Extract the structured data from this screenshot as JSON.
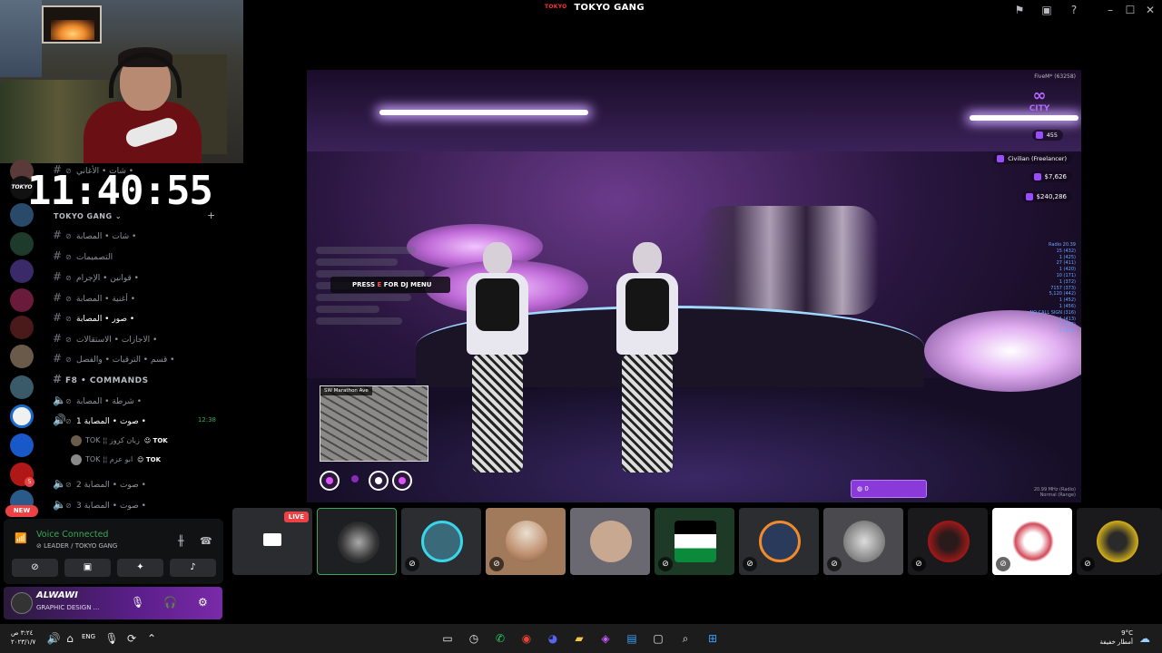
{
  "window": {
    "title": "TOKYO GANG",
    "logo_text": "TOKYO"
  },
  "titlebar_icons": [
    "inbox-flag-icon",
    "screen-share-icon",
    "help-icon",
    "minimize-icon",
    "maximize-icon",
    "close-icon"
  ],
  "overlay_clock": "11:40:55",
  "server_rail": {
    "new_badge": "NEW",
    "small_badge": "5",
    "tokyo_label": "TOKYO"
  },
  "channels": {
    "guild_name": "TOKYO GANG",
    "top_partial": "شات • الأغاني •",
    "items": [
      {
        "name": "شات • المصابة •",
        "type": "text"
      },
      {
        "name": "التصميمات",
        "type": "text"
      },
      {
        "name": "قوانين • الإجرام •",
        "type": "text"
      },
      {
        "name": "أغنية • المصابة •",
        "type": "text"
      },
      {
        "name": "صور • المصابة •",
        "type": "text",
        "active": true
      },
      {
        "name": "الاجازات • الاستقالات •",
        "type": "text"
      },
      {
        "name": "قسم • الترقيات • والفصل •",
        "type": "text"
      }
    ],
    "category": "F8 • COMMANDS",
    "voice_channels": [
      {
        "name": "شرطة • المصابة •",
        "time": ""
      },
      {
        "name": "صوت • المصابة 1 •",
        "time": "12:38",
        "active": true
      },
      {
        "name": "صوت • المصابة 2 •",
        "time": ""
      },
      {
        "name": "صوت • المصابة 3 •",
        "time": ""
      }
    ],
    "voice_users": [
      {
        "name": "TOK ¦¦ زيان كروز",
        "tag": "TOK"
      },
      {
        "name": "TOK ¦¦ ابو عزم",
        "tag": "TOK"
      }
    ]
  },
  "voice_panel": {
    "title": "Voice Connected",
    "subtitle": "LEADER / TOKYO GANG",
    "buttons": [
      "camera-off-icon",
      "screen-share-icon",
      "activities-icon",
      "soundboard-icon"
    ]
  },
  "user_panel": {
    "name": "ALWAWI",
    "status": "GRAPHIC DESIGN ..."
  },
  "game_hud": {
    "fivem_tag": "FiveM* (63258)",
    "city_logo": "CITY",
    "player_id": "455",
    "job": "Civilian (Freelancer)",
    "cash": "$7,626",
    "bank": "$240,286",
    "dj_prompt_prefix": "PRESS",
    "dj_prompt_key": "E",
    "dj_prompt_suffix": "FOR DJ MENU",
    "minimap_street": "SW Marathon Ave",
    "radio_title": "Radio 20.39",
    "radio_lines": [
      "15 (432)",
      "1 (425)",
      "27 (411)",
      "1 (420)",
      "10 (171)",
      "1 (372)",
      "7157 (373)",
      "5,120 (442)",
      "1 (452)",
      "1 (456)",
      "NO CALL SIGN (316)",
      "1 (413)",
      "1 (482)",
      "5 (482)"
    ],
    "inventory_count": "0",
    "version_line1": "20.99 MHz (Radio)",
    "version_line2": "Normal (Range)"
  },
  "stream_tiles": [
    {
      "label": "stream-preview",
      "live": "LIVE"
    },
    {
      "label": "user-tile-1"
    },
    {
      "label": "user-tile-2"
    },
    {
      "label": "user-tile-3"
    },
    {
      "label": "user-tile-4"
    },
    {
      "label": "user-tile-5"
    },
    {
      "label": "user-tile-6"
    },
    {
      "label": "user-tile-7"
    },
    {
      "label": "user-tile-8"
    },
    {
      "label": "user-tile-9"
    },
    {
      "label": "user-tile-10"
    }
  ],
  "taskbar": {
    "time": "٣:٢٤ ص",
    "date": "٢٠٢٣/١/٧",
    "language": "ENG",
    "weather_temp": "9°C",
    "weather_desc": "أمطار خفيفة"
  },
  "colors": {
    "voice_green": "#3ba55c",
    "live_red": "#ed4245",
    "hud_purple": "#9a4dff",
    "user_panel_purple": "#5a1e8a"
  }
}
